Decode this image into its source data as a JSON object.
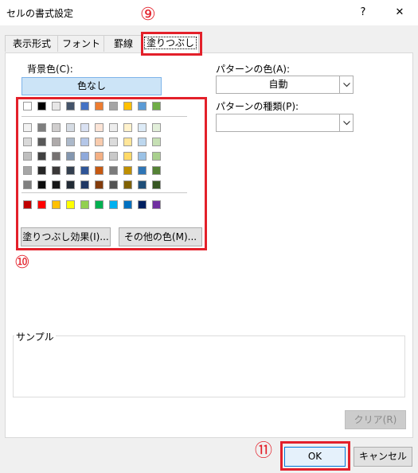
{
  "window": {
    "title": "セルの書式設定",
    "help_label": "?",
    "close_label": "✕"
  },
  "tabs": [
    {
      "label": "表示形式"
    },
    {
      "label": "フォント"
    },
    {
      "label": "罫線"
    },
    {
      "label": "塗りつぶし"
    }
  ],
  "background": {
    "label": "背景色(C):",
    "no_color_label": "色なし",
    "theme_top_row": [
      "#ffffff",
      "#000000",
      "#e7e6e6",
      "#44546a",
      "#4472c4",
      "#ed7d31",
      "#a5a5a5",
      "#ffc000",
      "#5b9bd5",
      "#70ad47"
    ],
    "theme_shades": [
      [
        "#f2f2f2",
        "#7f7f7f",
        "#d0cece",
        "#d6dce4",
        "#d9e1f2",
        "#fce4d6",
        "#ededed",
        "#fff2cc",
        "#ddebf7",
        "#e2efda"
      ],
      [
        "#d9d9d9",
        "#595959",
        "#aeaaaa",
        "#acb9ca",
        "#b4c6e7",
        "#f8cbad",
        "#dbdbdb",
        "#ffe699",
        "#bdd7ee",
        "#c6e0b4"
      ],
      [
        "#bfbfbf",
        "#404040",
        "#757171",
        "#8497b0",
        "#8ea9db",
        "#f4b084",
        "#c9c9c9",
        "#ffd966",
        "#9bc2e6",
        "#a9d08e"
      ],
      [
        "#a6a6a6",
        "#262626",
        "#3a3838",
        "#333f4f",
        "#2f5597",
        "#c65911",
        "#7b7b7b",
        "#bf8f00",
        "#2e75b6",
        "#548235"
      ],
      [
        "#808080",
        "#0d0d0d",
        "#161616",
        "#222b35",
        "#203864",
        "#833c0c",
        "#525252",
        "#806000",
        "#1f4e78",
        "#375623"
      ]
    ],
    "standard_colors": [
      "#c00000",
      "#ff0000",
      "#ffc000",
      "#ffff00",
      "#92d050",
      "#00b050",
      "#00b0f0",
      "#0070c0",
      "#002060",
      "#7030a0"
    ],
    "fill_effects_button": "塗りつぶし効果(I)...",
    "more_colors_button": "その他の色(M)..."
  },
  "pattern": {
    "color_label": "パターンの色(A):",
    "color_value": "自動",
    "style_label": "パターンの種類(P):",
    "style_value": ""
  },
  "sample": {
    "label": "サンプル"
  },
  "buttons": {
    "clear": "クリア(R)",
    "ok": "OK",
    "cancel": "キャンセル"
  },
  "annotations": {
    "marker_9": "⑨",
    "marker_10": "⑩",
    "marker_11": "⑪",
    "highlight_color": "#e3202a"
  }
}
